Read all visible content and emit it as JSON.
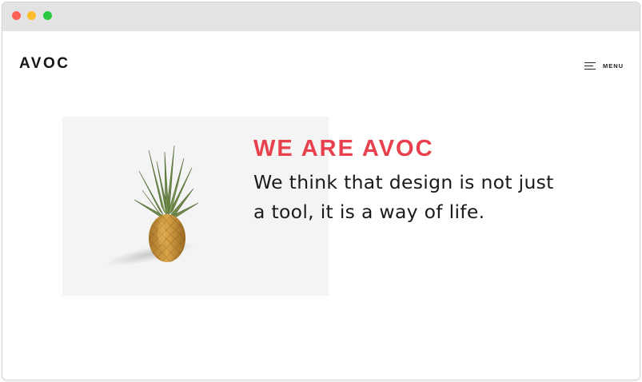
{
  "browser": {
    "controls": [
      "close",
      "minimize",
      "maximize"
    ]
  },
  "header": {
    "logo": "AVOC",
    "menu_label": "MENU",
    "menu_icon": "hamburger-icon"
  },
  "hero": {
    "image": "pineapple",
    "heading": "WE ARE AVOC",
    "text": "We think that design is not just a tool, it is a way of life."
  },
  "colors": {
    "accent": "#e8404d",
    "text": "#1a1a1a",
    "image_bg": "#f4f4f4"
  }
}
